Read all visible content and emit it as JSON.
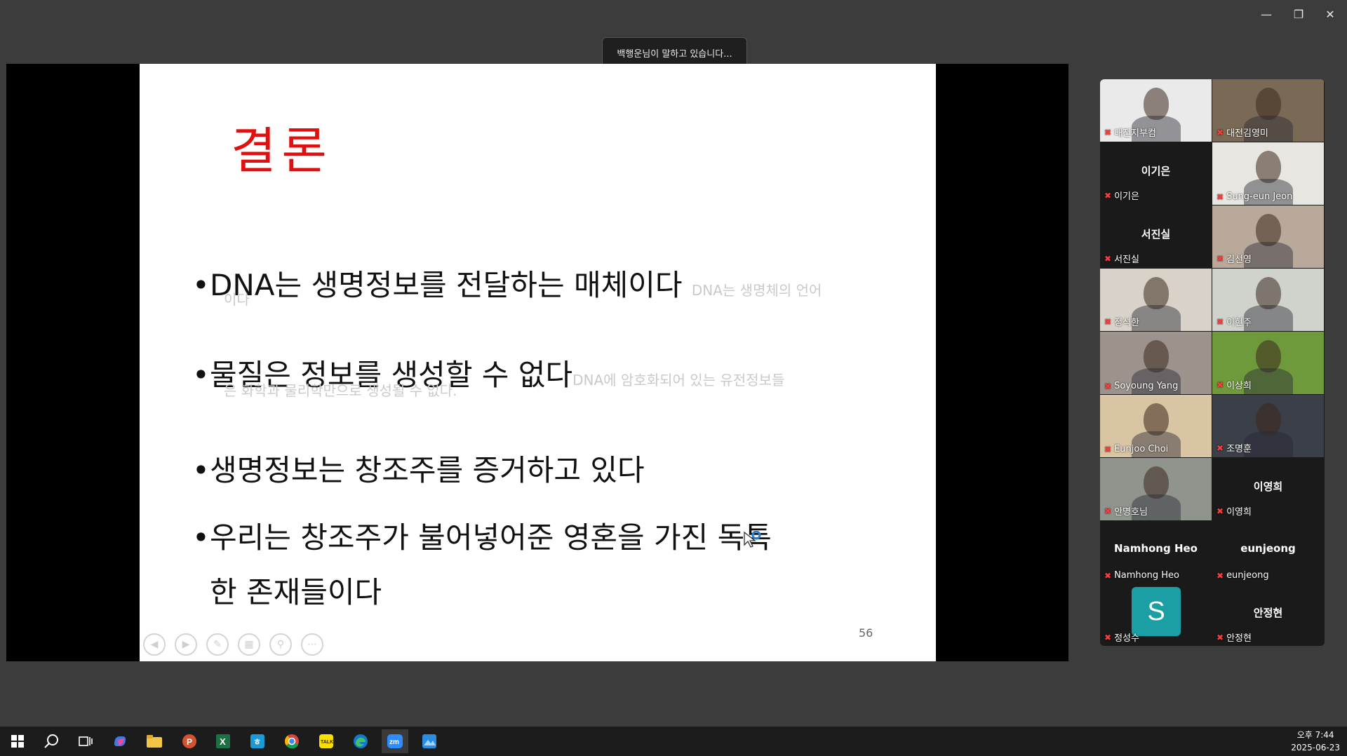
{
  "speaking_indicator": "백행운님이 말하고 있습니다...",
  "slide": {
    "title": "결론",
    "bullets": [
      {
        "text": "DNA는 생명정보를 전달하는 매체이다",
        "note": "DNA는 생명체의 언어",
        "note_cont": "이다"
      },
      {
        "text": "물질은 정보를 생성할 수 없다",
        "note": "DNA에 암호화되어 있는 유전정보들",
        "note_cont": "은 화학과 물리학만으로 생성될 수 없다."
      },
      {
        "text": "생명정보는 창조주를 증거하고 있다"
      },
      {
        "text": "우리는 창조주가 불어넣어준 영혼을 가진 독특",
        "text_cont": "한 존재들이다"
      }
    ],
    "page_number": "56"
  },
  "participants": [
    {
      "name": "대전지부컴",
      "video": true,
      "bg": "#eaeaea"
    },
    {
      "name": "대전김영미",
      "video": true,
      "bg": "#7a6a55"
    },
    {
      "name": "이기은",
      "big": "이기은",
      "video": false
    },
    {
      "name": "Sung-eun Jeon",
      "video": true,
      "bg": "#e8e6e0"
    },
    {
      "name": "서진실",
      "big": "서진실",
      "video": false
    },
    {
      "name": "김선영",
      "video": true,
      "bg": "#b9a99a"
    },
    {
      "name": "정석한",
      "video": true,
      "bg": "#d8d2c8"
    },
    {
      "name": "이현주",
      "video": true,
      "bg": "#cfd3cc"
    },
    {
      "name": "Soyoung Yang",
      "video": true,
      "bg": "#9c948c"
    },
    {
      "name": "이상희",
      "video": true,
      "bg": "#6f9a3c"
    },
    {
      "name": "Eunjoo Choi",
      "video": true,
      "bg": "#d9c4a4"
    },
    {
      "name": "조명훈",
      "video": true,
      "bg": "#3a3f48"
    },
    {
      "name": "안명호님",
      "video": true,
      "bg": "#8f948c"
    },
    {
      "name": "이영희",
      "big": "이영희",
      "video": false
    },
    {
      "name": "Namhong Heo",
      "big": "Namhong Heo",
      "video": false
    },
    {
      "name": "eunjeong",
      "big": "eunjeong",
      "video": false
    },
    {
      "name": "정성수",
      "avatar": "S",
      "video": false
    },
    {
      "name": "안정현",
      "big": "안정현",
      "video": false
    }
  ],
  "taskbar": {
    "time": "오후 7:44",
    "date": "2025-06-23"
  }
}
